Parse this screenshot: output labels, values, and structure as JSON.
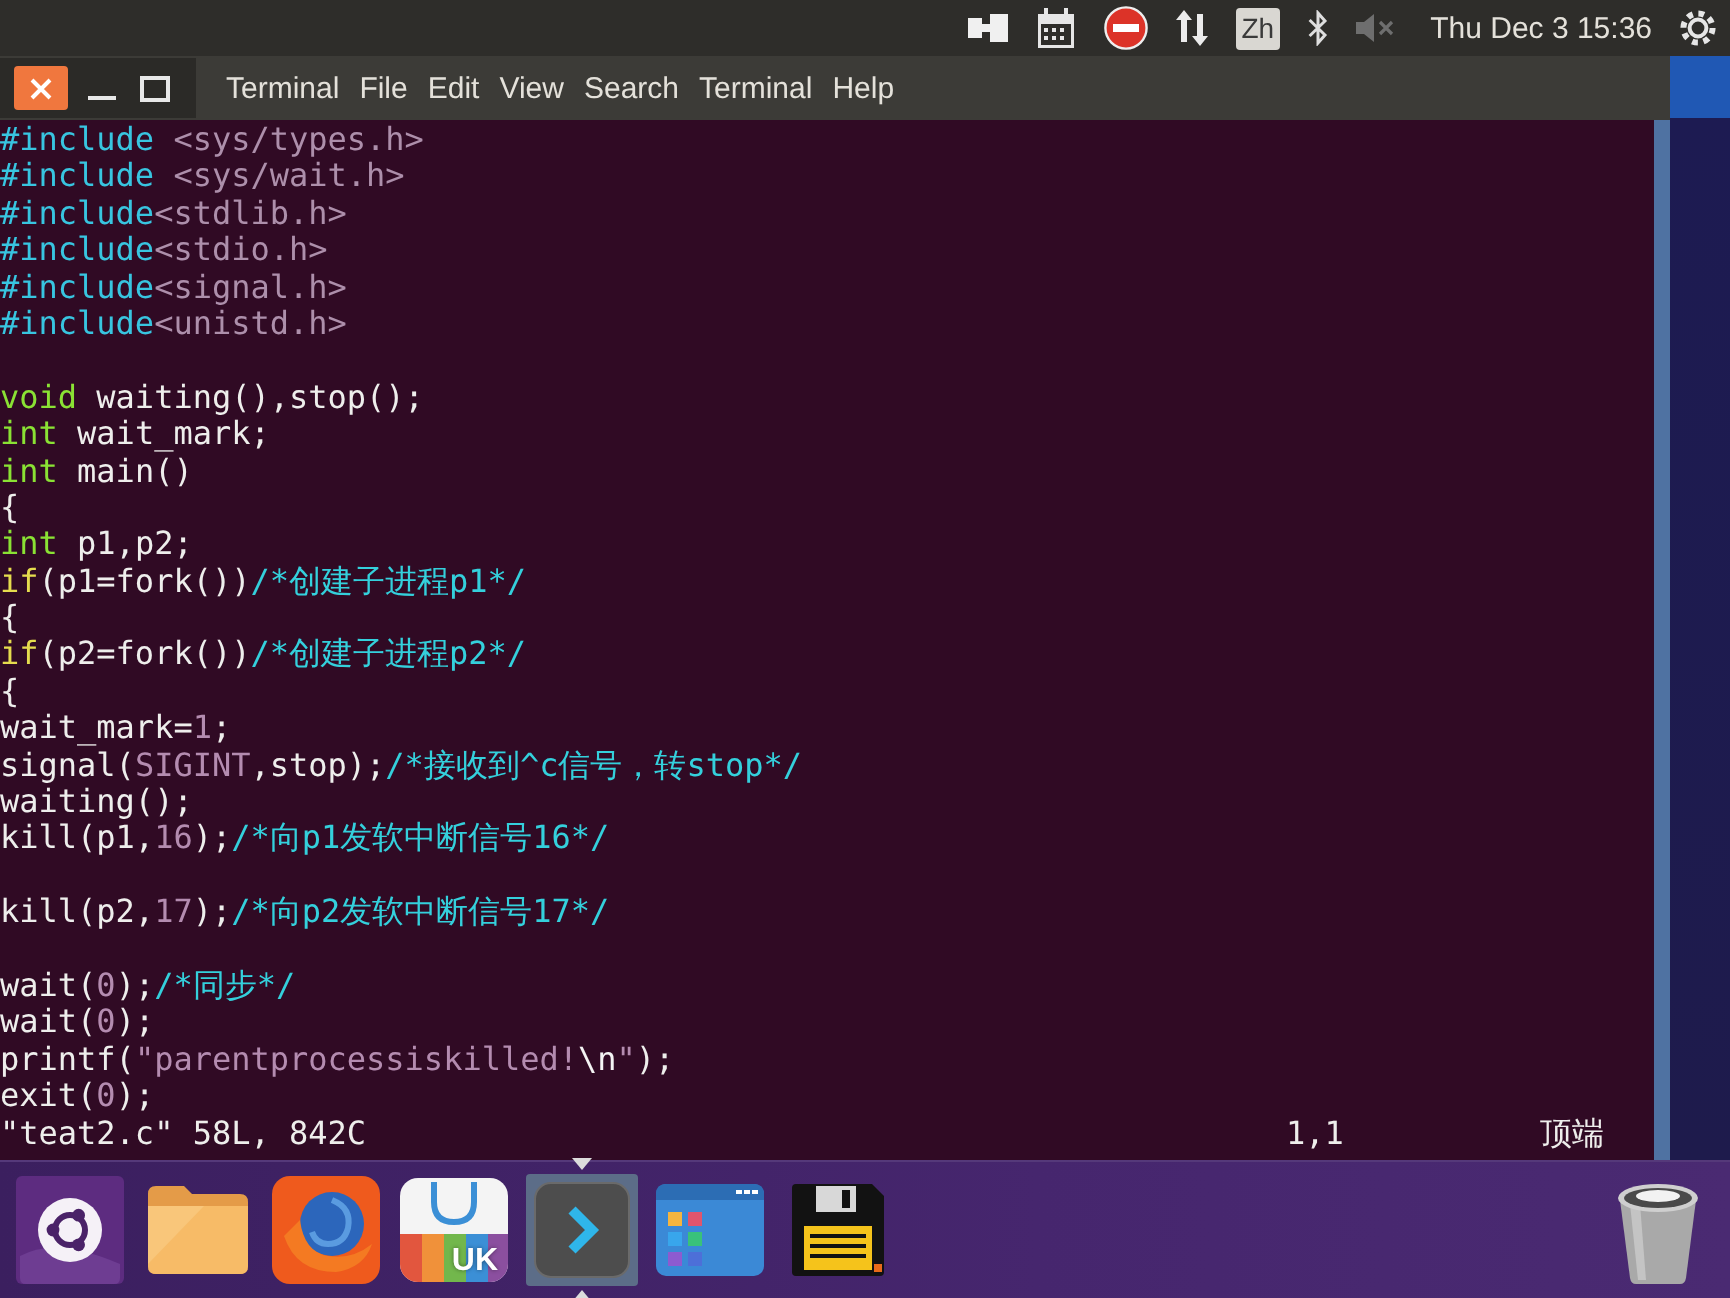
{
  "top_panel": {
    "indicators": [
      {
        "kind": "plug"
      },
      {
        "kind": "calendar"
      },
      {
        "kind": "no-entry"
      },
      {
        "kind": "transfer"
      },
      {
        "kind": "keyboard",
        "label": "Zh"
      },
      {
        "kind": "bluetooth"
      },
      {
        "kind": "volume-muted"
      }
    ],
    "clock": "Thu Dec 3 15:36"
  },
  "menu": [
    "Terminal",
    "File",
    "Edit",
    "View",
    "Search",
    "Terminal",
    "Help"
  ],
  "editor": {
    "lines": [
      {
        "kind": "code",
        "segments": [
          {
            "kind": "preproc",
            "text": "#include"
          },
          {
            "kind": "path",
            "text": " <sys/types.h>"
          }
        ]
      },
      {
        "kind": "code",
        "segments": [
          {
            "kind": "preproc",
            "text": "#include"
          },
          {
            "kind": "path",
            "text": " <sys/wait.h>"
          }
        ]
      },
      {
        "kind": "code",
        "segments": [
          {
            "kind": "preproc",
            "text": "#include"
          },
          {
            "kind": "path",
            "text": "<stdlib.h>"
          }
        ]
      },
      {
        "kind": "code",
        "segments": [
          {
            "kind": "preproc",
            "text": "#include"
          },
          {
            "kind": "path",
            "text": "<stdio.h>"
          }
        ]
      },
      {
        "kind": "code",
        "segments": [
          {
            "kind": "preproc",
            "text": "#include"
          },
          {
            "kind": "path",
            "text": "<signal.h>"
          }
        ]
      },
      {
        "kind": "code",
        "segments": [
          {
            "kind": "preproc",
            "text": "#include"
          },
          {
            "kind": "path",
            "text": "<unistd.h>"
          }
        ]
      },
      {
        "kind": "blank"
      },
      {
        "kind": "code",
        "segments": [
          {
            "kind": "type",
            "text": "void"
          },
          {
            "kind": "plain",
            "text": " waiting(),stop();"
          }
        ]
      },
      {
        "kind": "code",
        "segments": [
          {
            "kind": "type",
            "text": "int"
          },
          {
            "kind": "plain",
            "text": " wait_mark;"
          }
        ]
      },
      {
        "kind": "code",
        "segments": [
          {
            "kind": "type",
            "text": "int"
          },
          {
            "kind": "plain",
            "text": " main()"
          }
        ]
      },
      {
        "kind": "code",
        "segments": [
          {
            "kind": "plain",
            "text": "{"
          }
        ]
      },
      {
        "kind": "code",
        "segments": [
          {
            "kind": "type",
            "text": "int"
          },
          {
            "kind": "plain",
            "text": " p1,p2;"
          }
        ]
      },
      {
        "kind": "code",
        "segments": [
          {
            "kind": "keyword",
            "text": "if"
          },
          {
            "kind": "plain",
            "text": "(p1=fork())"
          },
          {
            "kind": "comment",
            "text": "/*创建子进程p1*/"
          }
        ]
      },
      {
        "kind": "code",
        "segments": [
          {
            "kind": "plain",
            "text": "{"
          }
        ]
      },
      {
        "kind": "code",
        "segments": [
          {
            "kind": "keyword",
            "text": "if"
          },
          {
            "kind": "plain",
            "text": "(p2=fork())"
          },
          {
            "kind": "comment",
            "text": "/*创建子进程p2*/"
          }
        ]
      },
      {
        "kind": "code",
        "segments": [
          {
            "kind": "plain",
            "text": "{"
          }
        ]
      },
      {
        "kind": "code",
        "segments": [
          {
            "kind": "plain",
            "text": "wait_mark="
          },
          {
            "kind": "constant",
            "text": "1"
          },
          {
            "kind": "plain",
            "text": ";"
          }
        ]
      },
      {
        "kind": "code",
        "segments": [
          {
            "kind": "plain",
            "text": "signal("
          },
          {
            "kind": "constant",
            "text": "SIGINT"
          },
          {
            "kind": "plain",
            "text": ",stop);"
          },
          {
            "kind": "comment",
            "text": "/*接收到^c信号，转stop*/"
          }
        ]
      },
      {
        "kind": "code",
        "segments": [
          {
            "kind": "plain",
            "text": "waiting();"
          }
        ]
      },
      {
        "kind": "code",
        "segments": [
          {
            "kind": "plain",
            "text": "kill(p1,"
          },
          {
            "kind": "constant",
            "text": "16"
          },
          {
            "kind": "plain",
            "text": ");"
          },
          {
            "kind": "comment",
            "text": "/*向p1发软中断信号16*/"
          }
        ]
      },
      {
        "kind": "blank"
      },
      {
        "kind": "code",
        "segments": [
          {
            "kind": "plain",
            "text": "kill(p2,"
          },
          {
            "kind": "constant",
            "text": "17"
          },
          {
            "kind": "plain",
            "text": ");"
          },
          {
            "kind": "comment",
            "text": "/*向p2发软中断信号17*/"
          }
        ]
      },
      {
        "kind": "blank"
      },
      {
        "kind": "code",
        "segments": [
          {
            "kind": "plain",
            "text": "wait("
          },
          {
            "kind": "constant",
            "text": "0"
          },
          {
            "kind": "plain",
            "text": ");"
          },
          {
            "kind": "comment",
            "text": "/*同步*/"
          }
        ]
      },
      {
        "kind": "code",
        "segments": [
          {
            "kind": "plain",
            "text": "wait("
          },
          {
            "kind": "constant",
            "text": "0"
          },
          {
            "kind": "plain",
            "text": ");"
          }
        ]
      },
      {
        "kind": "code",
        "segments": [
          {
            "kind": "plain",
            "text": "printf("
          },
          {
            "kind": "string",
            "text": "\"parentprocessiskilled!"
          },
          {
            "kind": "special",
            "text": "\\n"
          },
          {
            "kind": "string",
            "text": "\""
          },
          {
            "kind": "plain",
            "text": ");"
          }
        ]
      },
      {
        "kind": "code",
        "segments": [
          {
            "kind": "plain",
            "text": "exit("
          },
          {
            "kind": "constant",
            "text": "0"
          },
          {
            "kind": "plain",
            "text": ");"
          }
        ]
      }
    ],
    "status": {
      "file_info": "\"teat2.c\" 58L, 842C",
      "cursor": "1,1",
      "position": "顶端"
    }
  },
  "dock": {
    "launchers": [
      {
        "kind": "logo",
        "selected": false
      },
      {
        "kind": "folder",
        "selected": false
      },
      {
        "kind": "browser",
        "selected": false
      },
      {
        "kind": "store",
        "label": "UK",
        "selected": false
      },
      {
        "kind": "terminal",
        "selected": true
      },
      {
        "kind": "apps",
        "selected": false
      },
      {
        "kind": "save",
        "selected": false
      },
      {
        "kind": "trash",
        "selected": false
      }
    ]
  }
}
